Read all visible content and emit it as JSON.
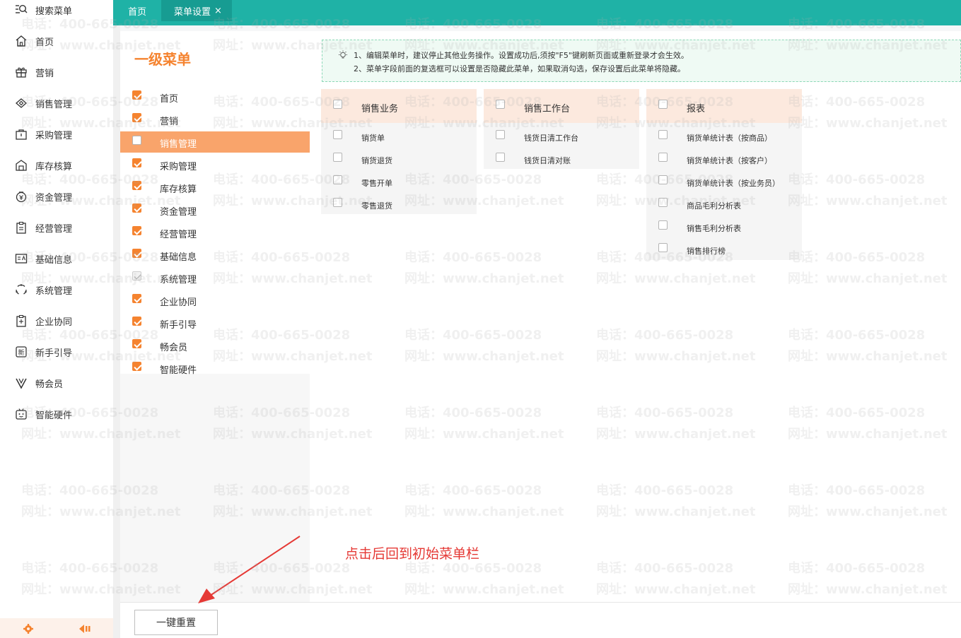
{
  "sidebar": {
    "items": [
      {
        "label": "搜索菜单",
        "icon": "search-menu-icon"
      },
      {
        "label": "首页",
        "icon": "home-icon"
      },
      {
        "label": "营销",
        "icon": "gift-icon"
      },
      {
        "label": "销售管理",
        "icon": "sales-icon"
      },
      {
        "label": "采购管理",
        "icon": "purchase-icon"
      },
      {
        "label": "库存核算",
        "icon": "warehouse-icon"
      },
      {
        "label": "资金管理",
        "icon": "money-icon"
      },
      {
        "label": "经营管理",
        "icon": "clipboard-icon"
      },
      {
        "label": "基础信息",
        "icon": "id-card-icon"
      },
      {
        "label": "系统管理",
        "icon": "system-icon"
      },
      {
        "label": "企业协同",
        "icon": "collaboration-icon"
      },
      {
        "label": "新手引导",
        "icon": "guide-icon"
      },
      {
        "label": "畅会员",
        "icon": "vip-icon"
      },
      {
        "label": "智能硬件",
        "icon": "hardware-icon"
      }
    ],
    "footer_icons": [
      "gear-icon",
      "collapse-sidebar-icon"
    ]
  },
  "tabs": {
    "home": "首页",
    "active": "菜单设置",
    "close_glyph": "×"
  },
  "level1": {
    "title": "一级菜单",
    "items": [
      {
        "label": "首页",
        "checked": true
      },
      {
        "label": "营销",
        "checked": true
      },
      {
        "label": "销售管理",
        "checked": false,
        "active": true
      },
      {
        "label": "采购管理",
        "checked": true
      },
      {
        "label": "库存核算",
        "checked": true
      },
      {
        "label": "资金管理",
        "checked": true
      },
      {
        "label": "经营管理",
        "checked": true
      },
      {
        "label": "基础信息",
        "checked": true
      },
      {
        "label": "系统管理",
        "checked": true,
        "disabled": true
      },
      {
        "label": "企业协同",
        "checked": true
      },
      {
        "label": "新手引导",
        "checked": true
      },
      {
        "label": "畅会员",
        "checked": true
      },
      {
        "label": "智能硬件",
        "checked": true
      }
    ]
  },
  "tip": {
    "line1": "1、编辑菜单时，建议停止其他业务操作。设置成功后,须按\"F5\"键刷新页面或重新登录才会生效。",
    "line2": "2、菜单字段前面的复选框可以设置是否隐藏此菜单，如果取消勾选，保存设置后此菜单将隐藏。"
  },
  "groups": [
    {
      "title": "销售业务",
      "items": [
        "销货单",
        "销货退货",
        "零售开单",
        "零售退货"
      ]
    },
    {
      "title": "销售工作台",
      "items": [
        "钱货日清工作台",
        "钱货日清对账"
      ]
    },
    {
      "title": "报表",
      "items": [
        "销货单统计表（按商品）",
        "销货单统计表（按客户）",
        "销货单统计表（按业务员）",
        "商品毛利分析表",
        "销售毛利分析表",
        "销售排行榜"
      ]
    }
  ],
  "reset_button": "一键重置",
  "annotation": "点击后回到初始菜单栏",
  "watermark": {
    "phone": "电话：400-665-0028",
    "site": "网址：www.chanjet.net"
  },
  "colors": {
    "accent_orange": "#f5832f",
    "teal": "#1fb2a6",
    "annotation_red": "#e53935"
  }
}
